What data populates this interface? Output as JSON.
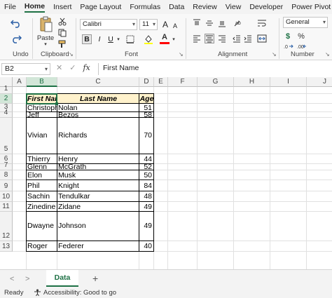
{
  "menu": [
    "File",
    "Home",
    "Insert",
    "Page Layout",
    "Formulas",
    "Data",
    "Review",
    "View",
    "Developer",
    "Power Pivot"
  ],
  "active_menu": "Home",
  "ribbon": {
    "undo_label": "Undo",
    "clipboard_label": "Clipboard",
    "paste_label": "Paste",
    "font_label": "Font",
    "font_name": "Calibri",
    "font_size": "11",
    "bold": "B",
    "italic": "I",
    "underline": "U",
    "grow_font": "A",
    "shrink_font": "A",
    "font_color_letter": "A",
    "alignment_label": "Alignment",
    "number_label": "Number",
    "number_format": "General",
    "currency_symbol": "$",
    "percent_symbol": "%",
    "accent_color": "#1e7145",
    "font_color": "#ff0000",
    "highlight_color": "#ffff00"
  },
  "formula_bar": {
    "name_box": "B2",
    "cancel_symbol": "✕",
    "enter_symbol": "✓",
    "fx_symbol": "fx",
    "formula": "First Name"
  },
  "columns": [
    "A",
    "B",
    "C",
    "D",
    "E",
    "F",
    "G",
    "H",
    "I",
    "J"
  ],
  "rows": [
    "1",
    "2",
    "3",
    "4",
    "5",
    "6",
    "7",
    "8",
    "9",
    "10",
    "11",
    "12",
    "13"
  ],
  "table": {
    "headers": [
      "First Name",
      "Last Name",
      "Age"
    ],
    "header_fill": "#fff2cc",
    "rows": [
      {
        "first": "Christopher",
        "last": "Nolan",
        "age": "51"
      },
      {
        "first": "Jeff",
        "last": "Bezos",
        "age": "58"
      },
      {
        "first": "Vivian",
        "last": "Richards",
        "age": "70"
      },
      {
        "first": "Thierry",
        "last": "Henry",
        "age": "44"
      },
      {
        "first": "Glenn",
        "last": "McGrath",
        "age": "52"
      },
      {
        "first": "Elon",
        "last": "Musk",
        "age": "50"
      },
      {
        "first": "Phil",
        "last": "Knight",
        "age": "84"
      },
      {
        "first": "Sachin",
        "last": "Tendulkar",
        "age": "48"
      },
      {
        "first": "Zinedine",
        "last": "Zidane",
        "age": "49"
      },
      {
        "first": "Dwayne",
        "last": "Johnson",
        "age": "49"
      },
      {
        "first": "Roger",
        "last": "Federer",
        "age": "40"
      }
    ]
  },
  "tabs": {
    "prev": "<",
    "next": ">",
    "sheet_name": "Data",
    "add": "+"
  },
  "status": {
    "ready": "Ready",
    "accessibility": "Accessibility: Good to go"
  }
}
